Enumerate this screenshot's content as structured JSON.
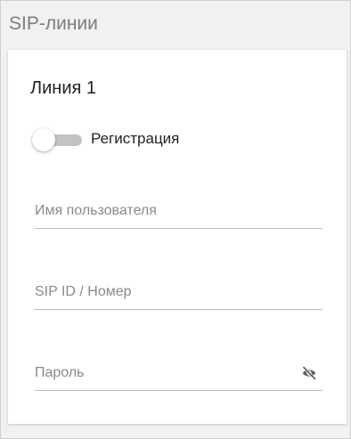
{
  "panel": {
    "title": "SIP-линии"
  },
  "line": {
    "title": "Линия 1",
    "registration_label": "Регистрация",
    "registration_enabled": false,
    "username_placeholder": "Имя пользователя",
    "username_value": "",
    "sipid_placeholder": "SIP ID / Номер",
    "sipid_value": "",
    "password_placeholder": "Пароль",
    "password_value": "",
    "password_visibility_icon": "eye-off-icon"
  },
  "colors": {
    "frame_bg": "#f1f1f1",
    "title_gray": "#7d7d7d",
    "toggle_track_off": "#c3c3c3"
  }
}
